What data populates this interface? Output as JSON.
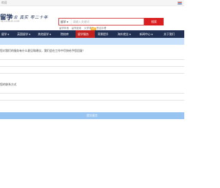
{
  "topbar": {
    "text": "欢迎"
  },
  "header": {
    "logo_text": "留学",
    "logo_sub": "MJ LIUXUE.COM",
    "slogan": "专业 真实 零二十年"
  },
  "search": {
    "category": "留学",
    "placeholder": "请输入关键词",
    "button": "搜索",
    "hot_links": [
      "留学申请",
      "留学费用",
      "大学排名",
      "签证办理"
    ]
  },
  "nav": {
    "items": [
      {
        "label": "留学",
        "has_arrow": true
      },
      {
        "label": "英国留学",
        "has_arrow": true
      },
      {
        "label": "其他留学",
        "has_arrow": true
      },
      {
        "label": "院校库",
        "has_arrow": false
      },
      {
        "label": "留学服务",
        "has_arrow": false,
        "hot": true,
        "tag": "HOT"
      },
      {
        "label": "背景提升",
        "has_arrow": false
      },
      {
        "label": "海外就业",
        "has_arrow": true
      },
      {
        "label": "新闻中心",
        "has_arrow": true
      },
      {
        "label": "关于我们",
        "has_arrow": false
      }
    ]
  },
  "form": {
    "question1": "您对我们的服务有什么意见和建议，我们会在工作中尽快给予您回复！",
    "question2": "您的联系方式",
    "submit": "提交留言"
  },
  "colors": {
    "nav_bg": "#202f52",
    "nav_hot": "#c21f1f",
    "search_btn": "#d91f1f",
    "banner": "#c9e1fa",
    "submit": "#97c4f0"
  }
}
